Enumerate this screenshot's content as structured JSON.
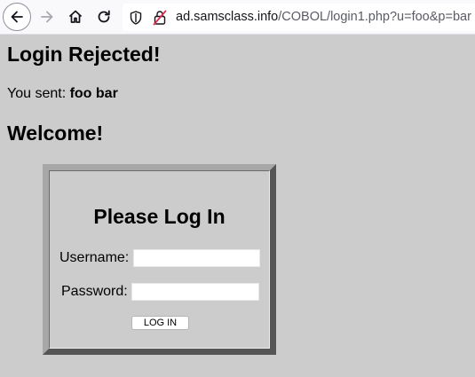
{
  "browser": {
    "url_host": "ad.samsclass.info",
    "url_path": "/COBOL/login1.php?u=foo&p=bar",
    "icons": {
      "back": "back-arrow-icon",
      "forward": "forward-arrow-icon",
      "home": "home-icon",
      "reload": "reload-icon",
      "tracking": "shield-icon",
      "security": "insecure-lock-icon"
    }
  },
  "page": {
    "rejected_heading": "Login Rejected!",
    "sent_label": "You sent: ",
    "sent_value": "foo bar",
    "welcome_heading": "Welcome!"
  },
  "login_form": {
    "title": "Please Log In",
    "username_label": "Username:",
    "username_value": "",
    "password_label": "Password:",
    "password_value": "",
    "submit_label": "LOG IN"
  }
}
